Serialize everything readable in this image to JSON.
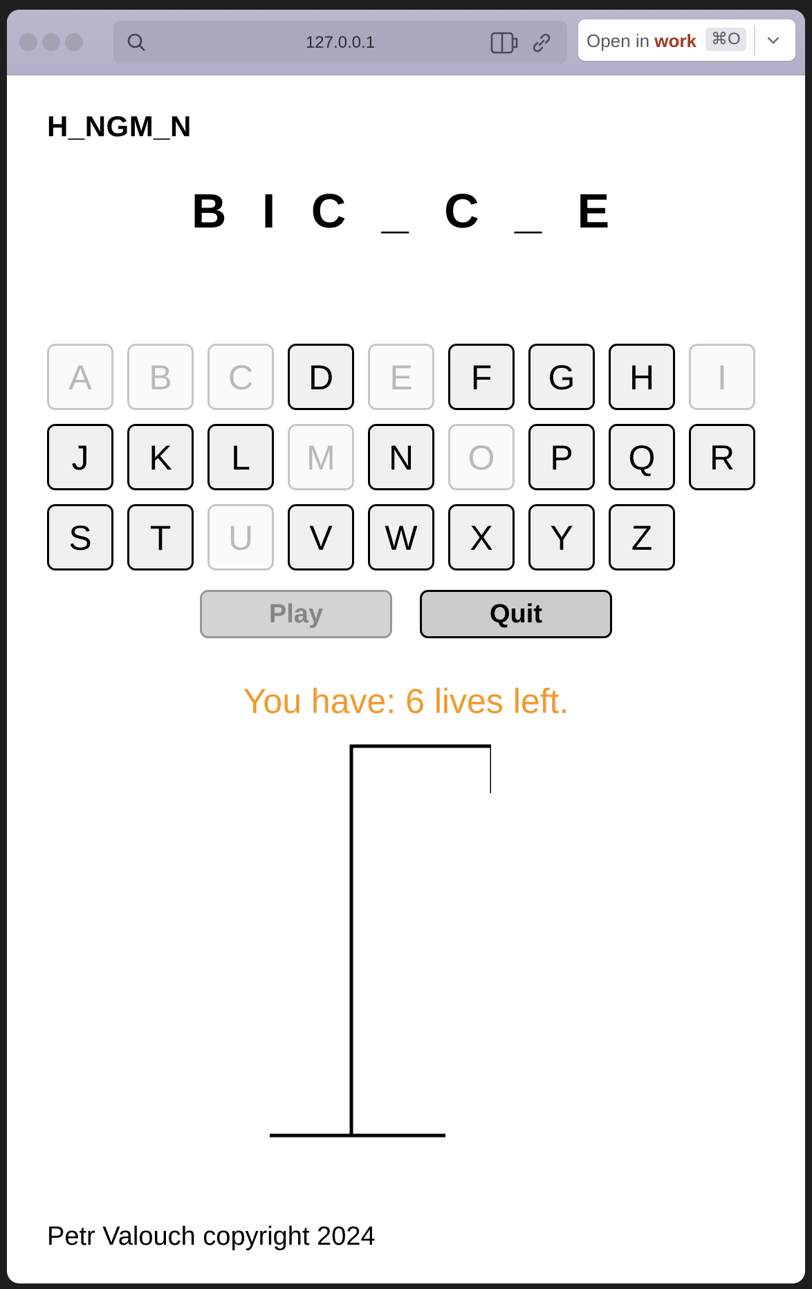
{
  "browser": {
    "url": "127.0.0.1",
    "open_in_prefix": "Open in ",
    "open_in_profile": "work",
    "shortcut": "⌘O"
  },
  "app": {
    "logo": "H_NGM_N",
    "word_display": "B I C _ C _ E",
    "keys": [
      {
        "letter": "A",
        "used": true
      },
      {
        "letter": "B",
        "used": true
      },
      {
        "letter": "C",
        "used": true
      },
      {
        "letter": "D",
        "used": false
      },
      {
        "letter": "E",
        "used": true
      },
      {
        "letter": "F",
        "used": false
      },
      {
        "letter": "G",
        "used": false
      },
      {
        "letter": "H",
        "used": false
      },
      {
        "letter": "I",
        "used": true
      },
      {
        "letter": "J",
        "used": false
      },
      {
        "letter": "K",
        "used": false
      },
      {
        "letter": "L",
        "used": false
      },
      {
        "letter": "M",
        "used": true
      },
      {
        "letter": "N",
        "used": false
      },
      {
        "letter": "O",
        "used": true
      },
      {
        "letter": "P",
        "used": false
      },
      {
        "letter": "Q",
        "used": false
      },
      {
        "letter": "R",
        "used": false
      },
      {
        "letter": "S",
        "used": false
      },
      {
        "letter": "T",
        "used": false
      },
      {
        "letter": "U",
        "used": true
      },
      {
        "letter": "V",
        "used": false
      },
      {
        "letter": "W",
        "used": false
      },
      {
        "letter": "X",
        "used": false
      },
      {
        "letter": "Y",
        "used": false
      },
      {
        "letter": "Z",
        "used": false
      }
    ],
    "play_label": "Play",
    "play_disabled": true,
    "quit_label": "Quit",
    "lives_text": "You have: 6 lives left.",
    "lives_remaining": 6,
    "footer": "Petr Valouch copyright 2024"
  },
  "colors": {
    "lives_text": "#ef9a2e",
    "brand_work": "#a3381e",
    "titlebar": "#b6b3cb"
  }
}
